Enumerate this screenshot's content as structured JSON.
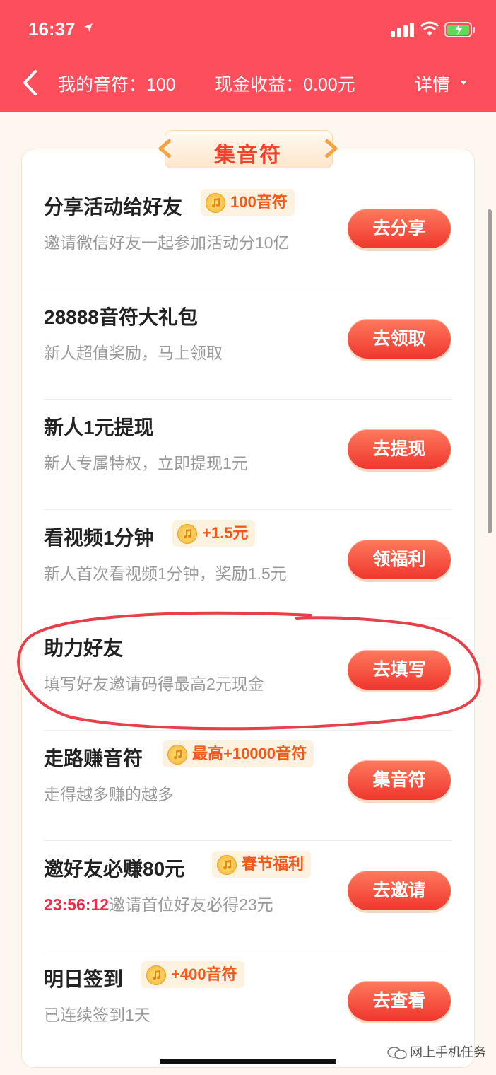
{
  "status_bar": {
    "time": "16:37"
  },
  "nav": {
    "notes_text": "我的音符：100",
    "cash_text": "现金收益：0.00元",
    "detail_label": "详情"
  },
  "section_title": "集音符",
  "tasks": [
    {
      "title": "分享活动给好友",
      "subtitle": "邀请微信好友一起参加活动分10亿",
      "badge": "100音符",
      "button": "去分享"
    },
    {
      "title": "28888音符大礼包",
      "subtitle": "新人超值奖励，马上领取",
      "button": "去领取"
    },
    {
      "title": "新人1元提现",
      "subtitle": "新人专属特权，立即提现1元",
      "button": "去提现"
    },
    {
      "title": "看视频1分钟",
      "subtitle": "新人首次看视频1分钟，奖励1.5元",
      "badge": "+1.5元",
      "button": "领福利"
    },
    {
      "title": "助力好友",
      "subtitle": "填写好友邀请码得最高2元现金",
      "button": "去填写"
    },
    {
      "title": "走路赚音符",
      "subtitle": "走得越多赚的越多",
      "badge": "最高+10000音符",
      "button": "集音符"
    },
    {
      "title": "邀好友必赚80元",
      "timer": "23:56:12",
      "subtitle": "邀请首位好友必得23元",
      "badge": "春节福利",
      "button": "去邀请"
    },
    {
      "title": "明日签到",
      "subtitle": "已连续签到1天",
      "badge": "+400音符",
      "button": "去查看"
    }
  ],
  "watermark": "网上手机任务",
  "colors": {
    "header": "#fd4e5c",
    "button": "#f0362e",
    "badge_text": "#f3591b",
    "annotation": "#e8404a"
  }
}
